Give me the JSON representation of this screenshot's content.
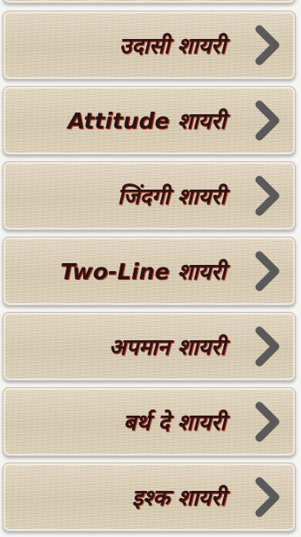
{
  "menu": {
    "items": [
      {
        "label": "उदासी शायरी"
      },
      {
        "label": "Attitude शायरी"
      },
      {
        "label": "जिंदगी शायरी"
      },
      {
        "label": "Two-Line शायरी"
      },
      {
        "label": "अपमान शायरी"
      },
      {
        "label": "बर्थ दे शायरी"
      },
      {
        "label": "इश्क शायरी"
      }
    ]
  },
  "icons": {
    "row_arrow": "chevron-right-icon"
  },
  "colors": {
    "label_text": "#2a1515",
    "label_shadow": "#c0392b",
    "chevron": "#5a5a5a",
    "card_base": "#d9cdb6"
  }
}
